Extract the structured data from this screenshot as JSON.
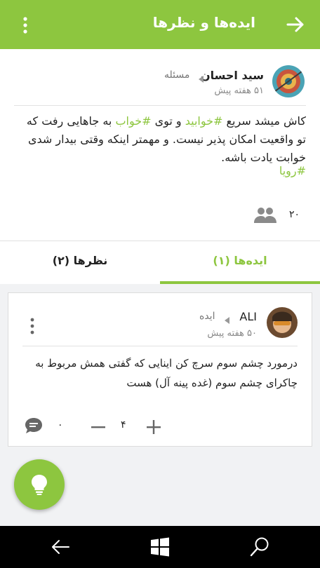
{
  "appbar": {
    "title": "ایده‌ها و نظرها",
    "back_icon": "arrow-right-icon",
    "more_icon": "more-vertical-icon"
  },
  "post": {
    "author": "سید احسان",
    "category": "مسئله",
    "time": "۵۱ هفته پیش",
    "body": {
      "part1": "کاش میشد سریع ",
      "tag1": "#خوابید",
      "part2": " و توی ",
      "tag2": "#خواب",
      "part3": " به جاهایی رفت که تو واقعیت امکان پذیر نیست. و مهمتر اینکه وقتی بیدار شدی خوابت یادت باشه."
    },
    "hashtag": "#رویا",
    "participants_count": "۲۰",
    "participants_icon": "people-icon"
  },
  "tabs": {
    "ideas_label": "ایده‌ها (۱)",
    "comments_label": "نظرها (۲)"
  },
  "idea_card": {
    "author": "ALI",
    "type": "ایده",
    "time": "۵۰ هفته پیش",
    "body": "درمورد چشم سوم سرچ کن اینایی که گفتی همش مربوط به چاکرای چشم سوم (غده پینه آل) هست",
    "comment_count": "۰",
    "vote_count": "۴"
  },
  "colors": {
    "accent": "#8dc63f",
    "background": "#f1f2f4",
    "navbar": "#000000"
  },
  "fab": {
    "icon": "lightbulb-icon"
  },
  "navbar": {
    "icons": [
      "back-arrow-icon",
      "windows-icon",
      "search-icon"
    ]
  }
}
